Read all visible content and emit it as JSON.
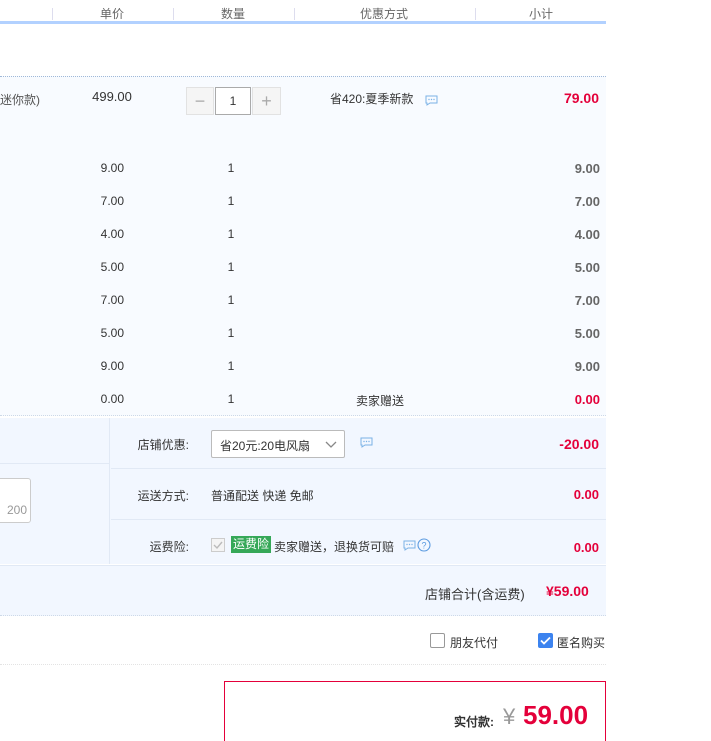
{
  "header": {
    "cols": [
      "单价",
      "数量",
      "优惠方式",
      "小计"
    ]
  },
  "main_item": {
    "desc_fragment": "迷你款)",
    "price": "499.00",
    "qty": "1",
    "promo": "省420:夏季新款",
    "subtotal": "79.00",
    "minus": "−",
    "plus": "+"
  },
  "sub_items": [
    {
      "price": "9.00",
      "qty": "1",
      "note": "",
      "subtotal": "9.00"
    },
    {
      "price": "7.00",
      "qty": "1",
      "note": "",
      "subtotal": "7.00"
    },
    {
      "price": "4.00",
      "qty": "1",
      "note": "",
      "subtotal": "4.00"
    },
    {
      "price": "5.00",
      "qty": "1",
      "note": "",
      "subtotal": "5.00"
    },
    {
      "price": "7.00",
      "qty": "1",
      "note": "",
      "subtotal": "7.00"
    },
    {
      "price": "5.00",
      "qty": "1",
      "note": "",
      "subtotal": "5.00"
    },
    {
      "price": "9.00",
      "qty": "1",
      "note": "",
      "subtotal": "9.00"
    },
    {
      "price": "0.00",
      "qty": "1",
      "note": "卖家赠送",
      "subtotal": "0.00"
    }
  ],
  "shop": {
    "discount_label": "店铺优惠:",
    "discount_select": "省20元:20电风扇",
    "discount_value": "-20.00",
    "shipping_label": "运送方式:",
    "shipping_text": "普通配送 快递 免邮",
    "shipping_value": "0.00",
    "insurance_label": "运费险:",
    "insurance_badge": "运费险",
    "insurance_text": "卖家赠送，退换货可赔",
    "insurance_value": "0.00",
    "message_count": "200",
    "total_label": "店铺合计(含运费)",
    "total_value": "¥59.00"
  },
  "options": {
    "friend_pay": "朋友代付",
    "anonymous": "匿名购买"
  },
  "payment": {
    "label": "实付款:",
    "currency": "¥",
    "amount": "59.00"
  },
  "colors": {
    "accent_red": "#e4003a",
    "header_blue": "#b2d1ff",
    "row_bg": "#f8fbff",
    "badge_green": "#36a858",
    "checkbox_blue": "#3c83ef"
  }
}
